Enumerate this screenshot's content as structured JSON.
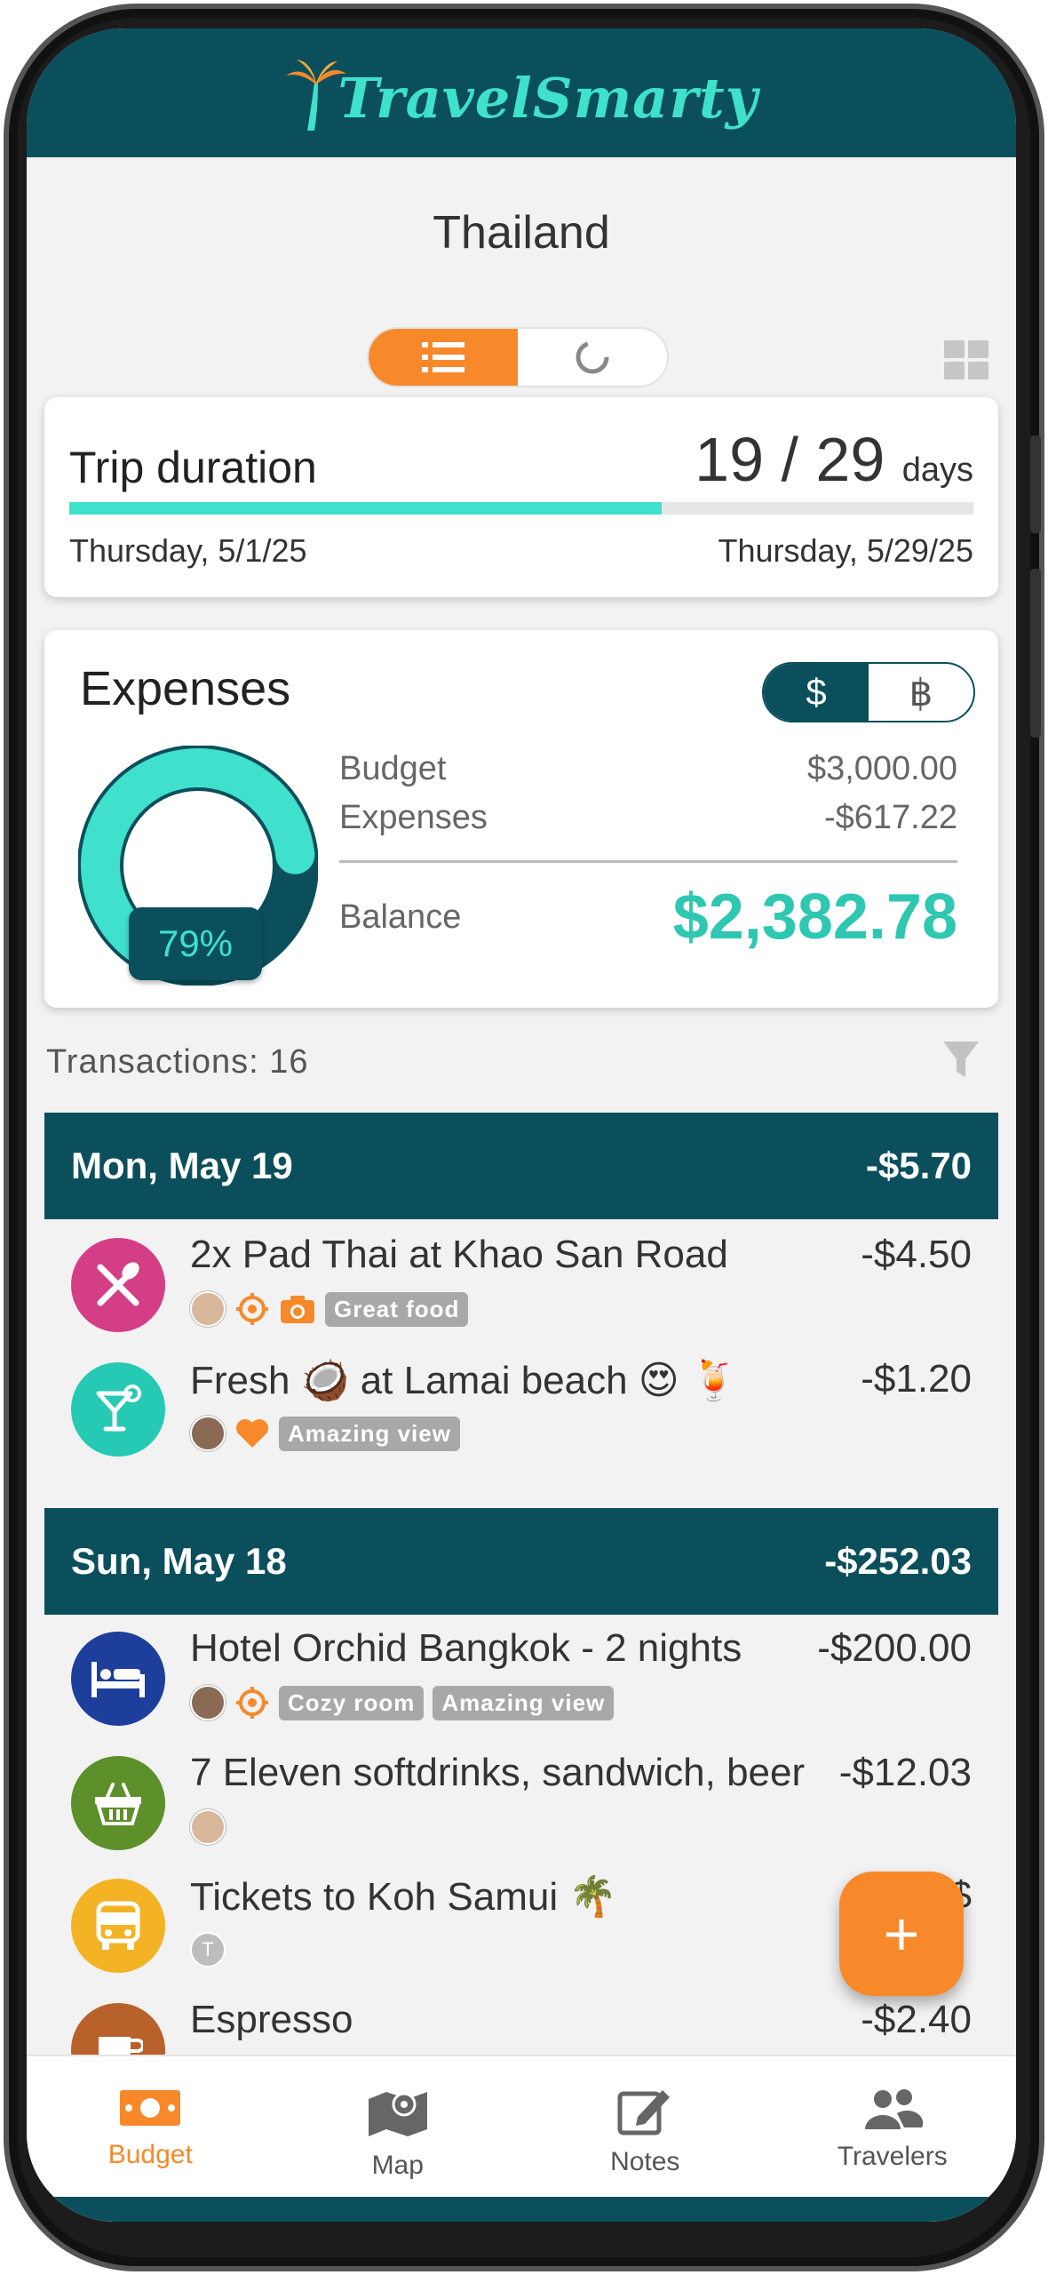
{
  "app": {
    "name": "TravelSmarty"
  },
  "page": {
    "title": "Thailand"
  },
  "view_toggle": {
    "options": [
      "list-icon",
      "chart-icon"
    ],
    "selected": "list-icon"
  },
  "trip": {
    "label": "Trip duration",
    "current": "19",
    "separator": "/",
    "total": "29",
    "unit": "days",
    "progress_fraction": 0.655,
    "start_date": "Thursday, 5/1/25",
    "end_date": "Thursday, 5/29/25"
  },
  "expenses": {
    "title": "Expenses",
    "currency_options": [
      "$",
      "฿"
    ],
    "currency_selected": "$",
    "percent": "79%",
    "percent_value": 0.79,
    "budget_label": "Budget",
    "budget_value": "$3,000.00",
    "expenses_label": "Expenses",
    "expenses_value": "-$617.22",
    "balance_label": "Balance",
    "balance_value": "$2,382.78"
  },
  "transactions": {
    "count_label": "Transactions: 16",
    "days": [
      {
        "date": "Mon, May 19",
        "total": "-$5.70",
        "items": [
          {
            "name": "2x Pad Thai at Khao San Road",
            "amount": "-$4.50",
            "icon": "fork-spoon-icon",
            "color": "#d43e86",
            "tags": [
              "Great food"
            ]
          },
          {
            "name": "Fresh 🥥 at Lamai beach 😍 🍹",
            "amount": "-$1.20",
            "icon": "cocktail-icon",
            "color": "#25c9b4",
            "tags": [
              "Amazing view"
            ]
          }
        ]
      },
      {
        "date": "Sun, May 18",
        "total": "-$252.03",
        "items": [
          {
            "name": "Hotel Orchid Bangkok - 2 nights",
            "amount": "-$200.00",
            "icon": "bed-icon",
            "color": "#1d3f9b",
            "tags": [
              "Cozy room",
              "Amazing view"
            ]
          },
          {
            "name": "7 Eleven softdrinks, sandwich, beer",
            "amount": "-$12.03",
            "icon": "basket-icon",
            "color": "#5d8f2a",
            "tags": []
          },
          {
            "name": "Tickets to Koh Samui 🌴",
            "amount": "-$",
            "icon": "bus-icon",
            "color": "#f4b324",
            "tags": [],
            "avatar_letter": "T"
          },
          {
            "name": "Espresso",
            "amount": "-$2.40",
            "icon": "coffee-icon",
            "color": "#b8612b",
            "tags": []
          }
        ]
      }
    ]
  },
  "fab": {
    "label": "+"
  },
  "bottom_nav": {
    "items": [
      {
        "label": "Budget",
        "icon": "money-icon"
      },
      {
        "label": "Map",
        "icon": "map-icon"
      },
      {
        "label": "Notes",
        "icon": "edit-note-icon"
      },
      {
        "label": "Travelers",
        "icon": "people-icon"
      }
    ],
    "selected": "Budget"
  },
  "colors": {
    "primary": "#0b4f5c",
    "accent": "#3fe0cc",
    "orange": "#f7892a",
    "balance": "#2ec7b1"
  }
}
